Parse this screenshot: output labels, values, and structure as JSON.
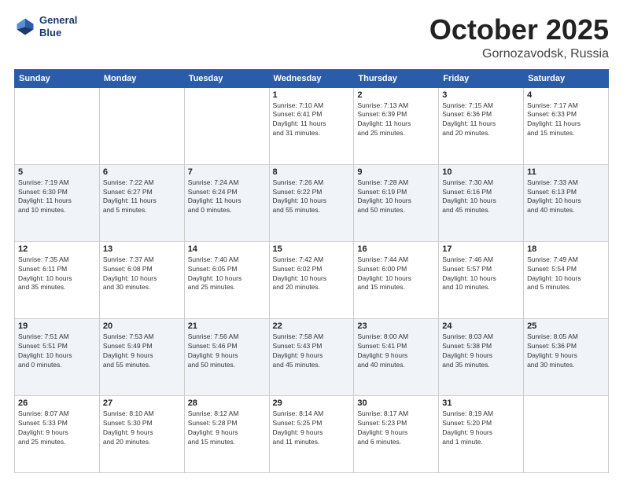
{
  "header": {
    "logo_line1": "General",
    "logo_line2": "Blue",
    "month": "October 2025",
    "location": "Gornozavodsk, Russia"
  },
  "weekdays": [
    "Sunday",
    "Monday",
    "Tuesday",
    "Wednesday",
    "Thursday",
    "Friday",
    "Saturday"
  ],
  "weeks": [
    [
      {
        "day": "",
        "info": ""
      },
      {
        "day": "",
        "info": ""
      },
      {
        "day": "",
        "info": ""
      },
      {
        "day": "1",
        "info": "Sunrise: 7:10 AM\nSunset: 6:41 PM\nDaylight: 11 hours\nand 31 minutes."
      },
      {
        "day": "2",
        "info": "Sunrise: 7:13 AM\nSunset: 6:39 PM\nDaylight: 11 hours\nand 25 minutes."
      },
      {
        "day": "3",
        "info": "Sunrise: 7:15 AM\nSunset: 6:36 PM\nDaylight: 11 hours\nand 20 minutes."
      },
      {
        "day": "4",
        "info": "Sunrise: 7:17 AM\nSunset: 6:33 PM\nDaylight: 11 hours\nand 15 minutes."
      }
    ],
    [
      {
        "day": "5",
        "info": "Sunrise: 7:19 AM\nSunset: 6:30 PM\nDaylight: 11 hours\nand 10 minutes."
      },
      {
        "day": "6",
        "info": "Sunrise: 7:22 AM\nSunset: 6:27 PM\nDaylight: 11 hours\nand 5 minutes."
      },
      {
        "day": "7",
        "info": "Sunrise: 7:24 AM\nSunset: 6:24 PM\nDaylight: 11 hours\nand 0 minutes."
      },
      {
        "day": "8",
        "info": "Sunrise: 7:26 AM\nSunset: 6:22 PM\nDaylight: 10 hours\nand 55 minutes."
      },
      {
        "day": "9",
        "info": "Sunrise: 7:28 AM\nSunset: 6:19 PM\nDaylight: 10 hours\nand 50 minutes."
      },
      {
        "day": "10",
        "info": "Sunrise: 7:30 AM\nSunset: 6:16 PM\nDaylight: 10 hours\nand 45 minutes."
      },
      {
        "day": "11",
        "info": "Sunrise: 7:33 AM\nSunset: 6:13 PM\nDaylight: 10 hours\nand 40 minutes."
      }
    ],
    [
      {
        "day": "12",
        "info": "Sunrise: 7:35 AM\nSunset: 6:11 PM\nDaylight: 10 hours\nand 35 minutes."
      },
      {
        "day": "13",
        "info": "Sunrise: 7:37 AM\nSunset: 6:08 PM\nDaylight: 10 hours\nand 30 minutes."
      },
      {
        "day": "14",
        "info": "Sunrise: 7:40 AM\nSunset: 6:05 PM\nDaylight: 10 hours\nand 25 minutes."
      },
      {
        "day": "15",
        "info": "Sunrise: 7:42 AM\nSunset: 6:02 PM\nDaylight: 10 hours\nand 20 minutes."
      },
      {
        "day": "16",
        "info": "Sunrise: 7:44 AM\nSunset: 6:00 PM\nDaylight: 10 hours\nand 15 minutes."
      },
      {
        "day": "17",
        "info": "Sunrise: 7:46 AM\nSunset: 5:57 PM\nDaylight: 10 hours\nand 10 minutes."
      },
      {
        "day": "18",
        "info": "Sunrise: 7:49 AM\nSunset: 5:54 PM\nDaylight: 10 hours\nand 5 minutes."
      }
    ],
    [
      {
        "day": "19",
        "info": "Sunrise: 7:51 AM\nSunset: 5:51 PM\nDaylight: 10 hours\nand 0 minutes."
      },
      {
        "day": "20",
        "info": "Sunrise: 7:53 AM\nSunset: 5:49 PM\nDaylight: 9 hours\nand 55 minutes."
      },
      {
        "day": "21",
        "info": "Sunrise: 7:56 AM\nSunset: 5:46 PM\nDaylight: 9 hours\nand 50 minutes."
      },
      {
        "day": "22",
        "info": "Sunrise: 7:58 AM\nSunset: 5:43 PM\nDaylight: 9 hours\nand 45 minutes."
      },
      {
        "day": "23",
        "info": "Sunrise: 8:00 AM\nSunset: 5:41 PM\nDaylight: 9 hours\nand 40 minutes."
      },
      {
        "day": "24",
        "info": "Sunrise: 8:03 AM\nSunset: 5:38 PM\nDaylight: 9 hours\nand 35 minutes."
      },
      {
        "day": "25",
        "info": "Sunrise: 8:05 AM\nSunset: 5:36 PM\nDaylight: 9 hours\nand 30 minutes."
      }
    ],
    [
      {
        "day": "26",
        "info": "Sunrise: 8:07 AM\nSunset: 5:33 PM\nDaylight: 9 hours\nand 25 minutes."
      },
      {
        "day": "27",
        "info": "Sunrise: 8:10 AM\nSunset: 5:30 PM\nDaylight: 9 hours\nand 20 minutes."
      },
      {
        "day": "28",
        "info": "Sunrise: 8:12 AM\nSunset: 5:28 PM\nDaylight: 9 hours\nand 15 minutes."
      },
      {
        "day": "29",
        "info": "Sunrise: 8:14 AM\nSunset: 5:25 PM\nDaylight: 9 hours\nand 11 minutes."
      },
      {
        "day": "30",
        "info": "Sunrise: 8:17 AM\nSunset: 5:23 PM\nDaylight: 9 hours\nand 6 minutes."
      },
      {
        "day": "31",
        "info": "Sunrise: 8:19 AM\nSunset: 5:20 PM\nDaylight: 9 hours\nand 1 minute."
      },
      {
        "day": "",
        "info": ""
      }
    ]
  ]
}
